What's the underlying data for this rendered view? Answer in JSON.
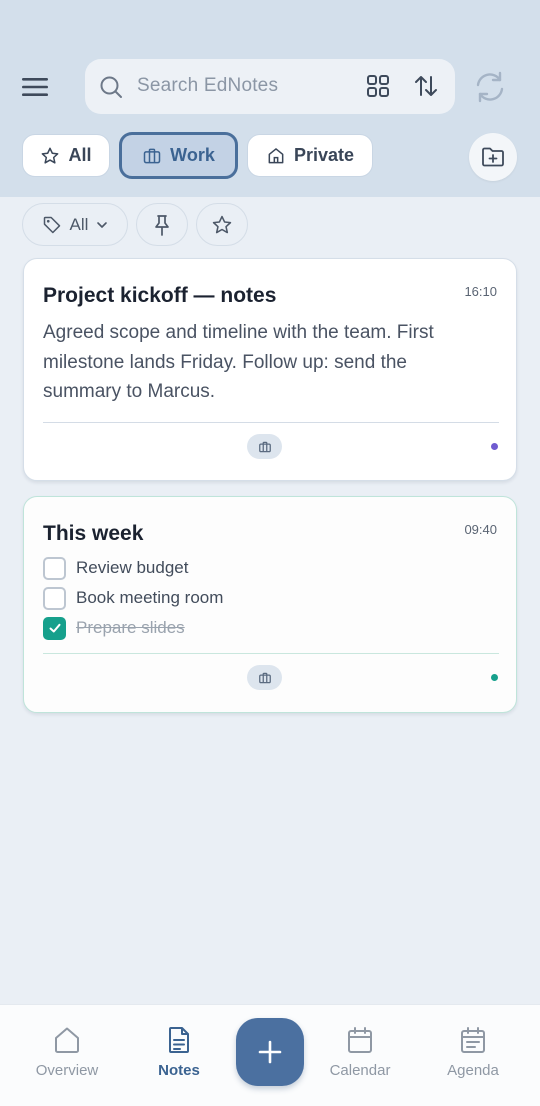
{
  "header": {
    "search_placeholder": "Search EdNotes"
  },
  "folders": [
    {
      "label": "All",
      "icon": "star-icon"
    },
    {
      "label": "Work",
      "icon": "briefcase-icon",
      "active": true
    },
    {
      "label": "Private",
      "icon": "home-icon"
    }
  ],
  "filters": {
    "tag_label": "All"
  },
  "notes": [
    {
      "title": "Project kickoff — notes",
      "time": "16:10",
      "body": "Agreed scope and timeline with the team. First milestone lands Friday. Follow up: send the summary to Marcus.",
      "dot_color": "#6f5bd0"
    },
    {
      "title": "This week",
      "time": "09:40",
      "checklist": [
        {
          "text": "Review budget",
          "checked": false
        },
        {
          "text": "Book meeting room",
          "checked": false
        },
        {
          "text": "Prepare slides",
          "checked": true
        }
      ],
      "dot_color": "#16a08c"
    }
  ],
  "nav": [
    {
      "label": "Overview",
      "icon": "home-icon"
    },
    {
      "label": "Notes",
      "icon": "document-icon",
      "active": true
    },
    {
      "label": "Calendar",
      "icon": "calendar-icon"
    },
    {
      "label": "Agenda",
      "icon": "agenda-icon"
    }
  ],
  "colors": {
    "accent": "#4b70a0",
    "header_bg": "#d3dfeb",
    "page_bg": "#eaeff5",
    "checked": "#16a08c"
  }
}
